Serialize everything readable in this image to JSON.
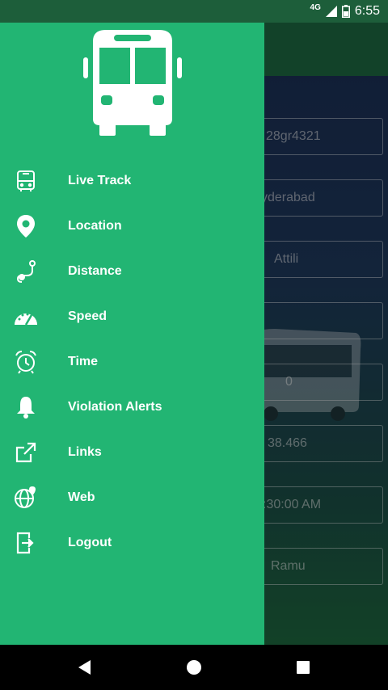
{
  "status_bar": {
    "network": "4G",
    "time": "6:55"
  },
  "background_fields": [
    "28gr4321",
    "yderabad",
    "Attili",
    "",
    "0",
    "38.466",
    ":30:00 AM",
    "Ramu"
  ],
  "drawer": {
    "header_icon": "bus-icon",
    "items": [
      {
        "label": "Live Track",
        "icon": "bus-outline-icon"
      },
      {
        "label": "Location",
        "icon": "map-pin-icon"
      },
      {
        "label": "Distance",
        "icon": "route-icon"
      },
      {
        "label": "Speed",
        "icon": "speedometer-icon"
      },
      {
        "label": "Time",
        "icon": "alarm-clock-icon"
      },
      {
        "label": "Violation Alerts",
        "icon": "bell-icon"
      },
      {
        "label": "Links",
        "icon": "external-link-icon"
      },
      {
        "label": "Web",
        "icon": "globe-icon"
      },
      {
        "label": "Logout",
        "icon": "logout-icon"
      }
    ]
  },
  "nav_bar": {
    "buttons": [
      "back-icon",
      "home-icon",
      "recents-icon"
    ]
  },
  "colors": {
    "drawer": "#22b573",
    "header": "#1d6b43",
    "statusbar": "#1d5e3a"
  }
}
